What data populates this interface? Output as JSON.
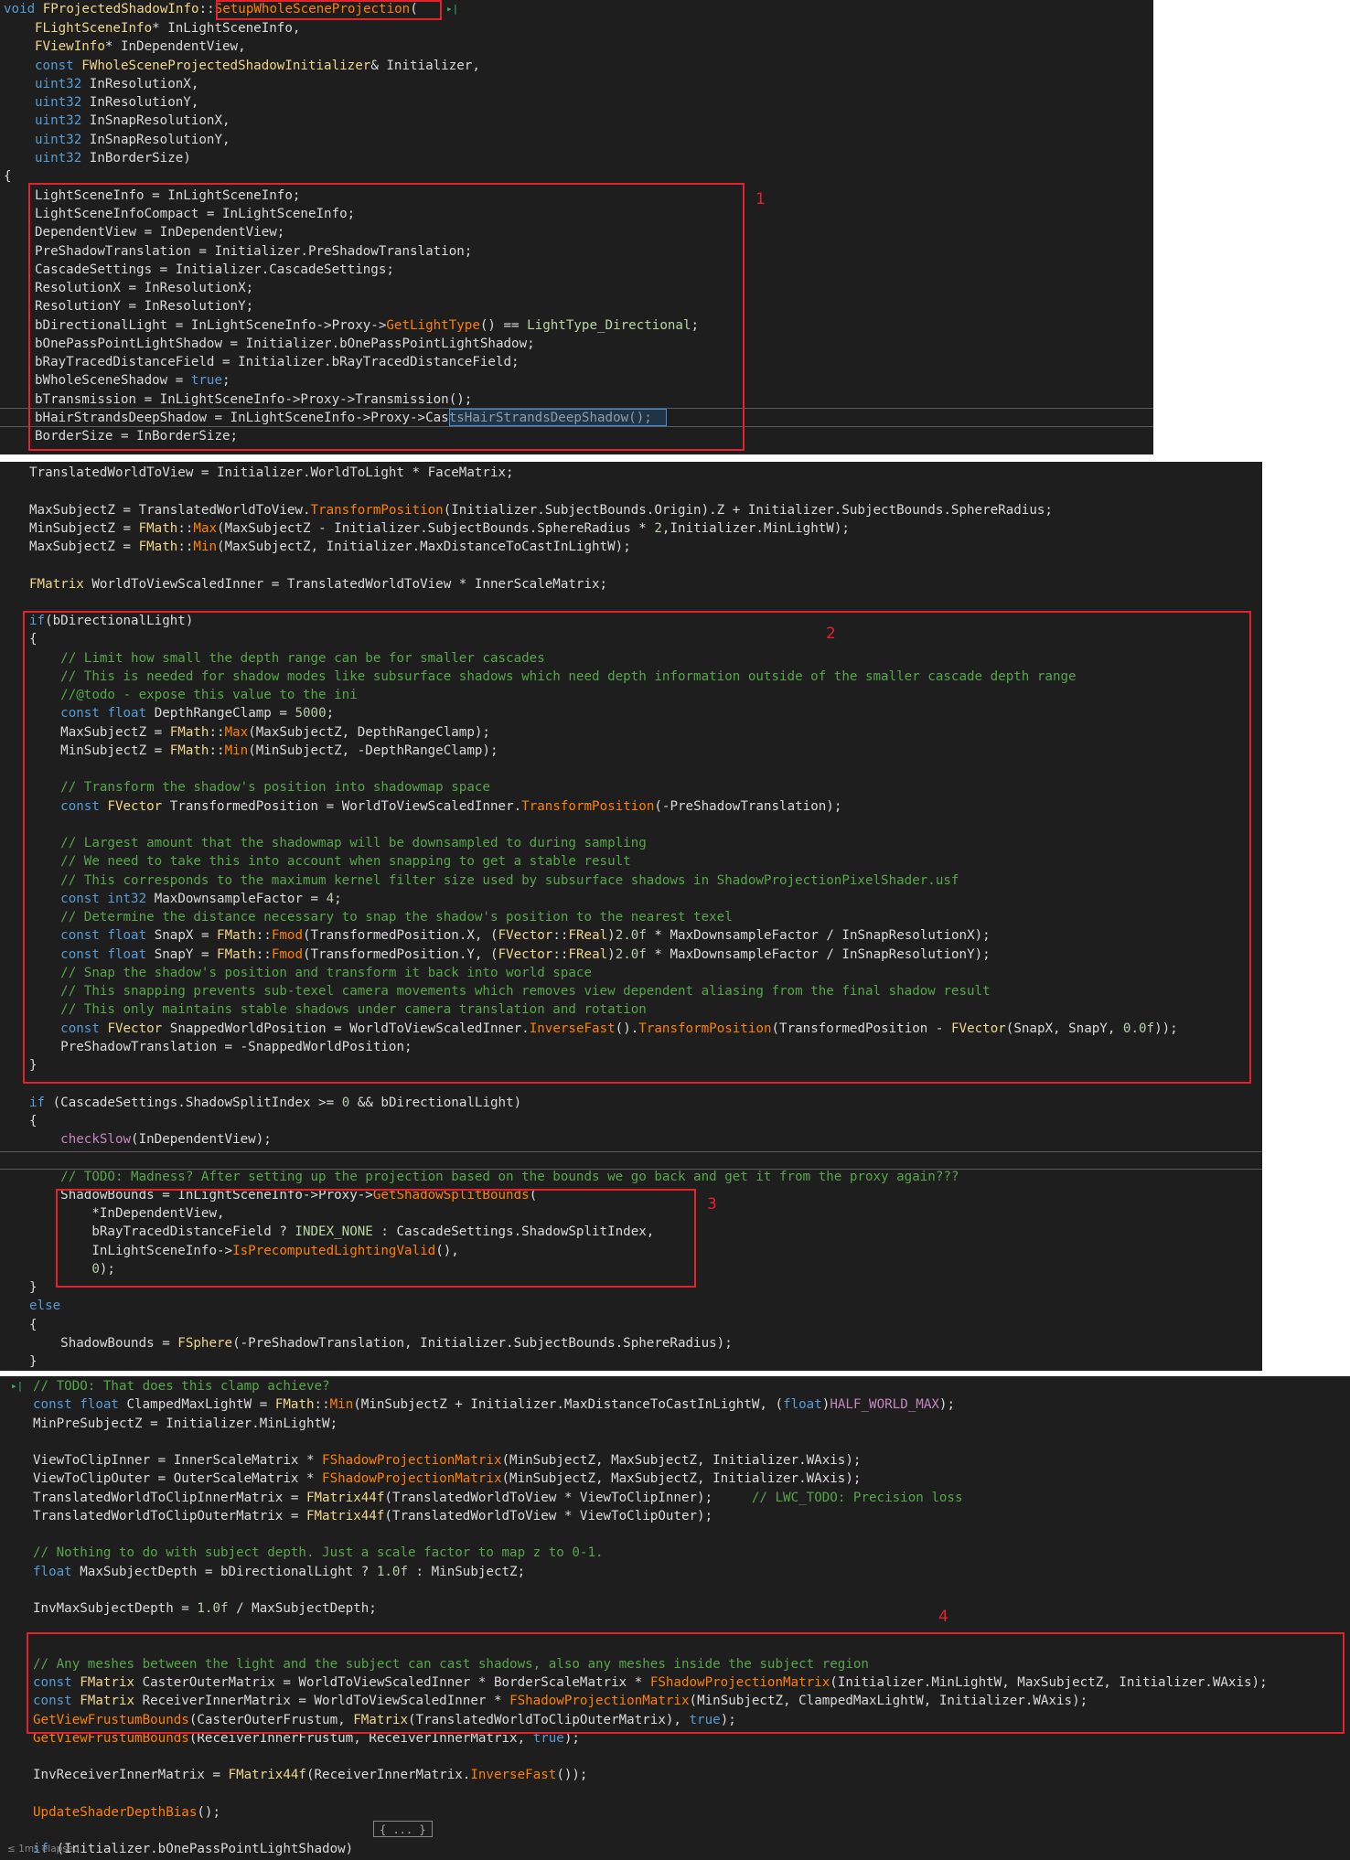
{
  "markers": {
    "m1": "1",
    "m2": "2",
    "m3": "3",
    "m4": "4"
  },
  "panel1": {
    "func_sig": [
      "void FProjectedShadowInfo::",
      "SetupWholeSceneProjection",
      "("
    ],
    "params": [
      "FLightSceneInfo* InLightSceneInfo,",
      "FViewInfo* InDependentView,",
      "const FWholeSceneProjectedShadowInitializer& Initializer,",
      "uint32 InResolutionX,",
      "uint32 InResolutionY,",
      "uint32 InSnapResolutionX,",
      "uint32 InSnapResolutionY,",
      "uint32 InBorderSize)"
    ],
    "brace": "{",
    "assignments": [
      "LightSceneInfo = InLightSceneInfo;",
      "LightSceneInfoCompact = InLightSceneInfo;",
      "DependentView = InDependentView;",
      "PreShadowTranslation = Initializer.PreShadowTranslation;",
      "CascadeSettings = Initializer.CascadeSettings;",
      "ResolutionX = InResolutionX;",
      "ResolutionY = InResolutionY;",
      "bDirectionalLight = InLightSceneInfo->Proxy->GetLightType() == LightType_Directional;",
      "bOnePassPointLightShadow = Initializer.bOnePassPointLightShadow;",
      "bRayTracedDistanceField = Initializer.bRayTracedDistanceField;",
      "bWholeSceneShadow = true;",
      "bTransmission = InLightSceneInfo->Proxy->Transmission();",
      "bHairStrandsDeepShadow = InLightSceneInfo->Proxy->CastsHairStrandsDeepShadow();",
      "BorderSize = InBorderSize;"
    ]
  },
  "panel2": {
    "lines": [
      "TranslatedWorldToView = Initializer.WorldToLight * FaceMatrix;",
      "",
      "MaxSubjectZ = TranslatedWorldToView.TransformPosition(Initializer.SubjectBounds.Origin).Z + Initializer.SubjectBounds.SphereRadius;",
      "MinSubjectZ = FMath::Max(MaxSubjectZ - Initializer.SubjectBounds.SphereRadius * 2,Initializer.MinLightW);",
      "MaxSubjectZ = FMath::Min(MaxSubjectZ, Initializer.MaxDistanceToCastInLightW);",
      "",
      "FMatrix WorldToViewScaledInner = TranslatedWorldToView * InnerScaleMatrix;",
      "",
      "if(bDirectionalLight)",
      "{",
      "    // Limit how small the depth range can be for smaller cascades",
      "    // This is needed for shadow modes like subsurface shadows which need depth information outside of the smaller cascade depth range",
      "    //@todo - expose this value to the ini",
      "    const float DepthRangeClamp = 5000;",
      "    MaxSubjectZ = FMath::Max(MaxSubjectZ, DepthRangeClamp);",
      "    MinSubjectZ = FMath::Min(MinSubjectZ, -DepthRangeClamp);",
      "",
      "    // Transform the shadow's position into shadowmap space",
      "    const FVector TransformedPosition = WorldToViewScaledInner.TransformPosition(-PreShadowTranslation);",
      "",
      "    // Largest amount that the shadowmap will be downsampled to during sampling",
      "    // We need to take this into account when snapping to get a stable result",
      "    // This corresponds to the maximum kernel filter size used by subsurface shadows in ShadowProjectionPixelShader.usf",
      "    const int32 MaxDownsampleFactor = 4;",
      "    // Determine the distance necessary to snap the shadow's position to the nearest texel",
      "    const float SnapX = FMath::Fmod(TransformedPosition.X, (FVector::FReal)2.0f * MaxDownsampleFactor / InSnapResolutionX);",
      "    const float SnapY = FMath::Fmod(TransformedPosition.Y, (FVector::FReal)2.0f * MaxDownsampleFactor / InSnapResolutionY);",
      "    // Snap the shadow's position and transform it back into world space",
      "    // This snapping prevents sub-texel camera movements which removes view dependent aliasing from the final shadow result",
      "    // This only maintains stable shadows under camera translation and rotation",
      "    const FVector SnappedWorldPosition = WorldToViewScaledInner.InverseFast().TransformPosition(TransformedPosition - FVector(SnapX, SnapY, 0.0f));",
      "    PreShadowTranslation = -SnappedWorldPosition;",
      "}",
      "",
      "if (CascadeSettings.ShadowSplitIndex >= 0 && bDirectionalLight)",
      "{",
      "    checkSlow(InDependentView);",
      "",
      "    // TODO: Madness? After setting up the projection based on the bounds we go back and get it from the proxy again???",
      "    ShadowBounds = InLightSceneInfo->Proxy->GetShadowSplitBounds(",
      "        *InDependentView,",
      "        bRayTracedDistanceField ? INDEX_NONE : CascadeSettings.ShadowSplitIndex,",
      "        InLightSceneInfo->IsPrecomputedLightingValid(),",
      "        0);",
      "}",
      "else",
      "{",
      "    ShadowBounds = FSphere(-PreShadowTranslation, Initializer.SubjectBounds.SphereRadius);",
      "}"
    ]
  },
  "panel3": {
    "lines": [
      "// TODO: That does this clamp achieve?",
      "const float ClampedMaxLightW = FMath::Min(MinSubjectZ + Initializer.MaxDistanceToCastInLightW, (float)HALF_WORLD_MAX);",
      "MinPreSubjectZ = Initializer.MinLightW;",
      "",
      "ViewToClipInner = InnerScaleMatrix * FShadowProjectionMatrix(MinSubjectZ, MaxSubjectZ, Initializer.WAxis);",
      "ViewToClipOuter = OuterScaleMatrix * FShadowProjectionMatrix(MinSubjectZ, MaxSubjectZ, Initializer.WAxis);",
      "TranslatedWorldToClipInnerMatrix = FMatrix44f(TranslatedWorldToView * ViewToClipInner);     // LWC_TODO: Precision loss",
      "TranslatedWorldToClipOuterMatrix = FMatrix44f(TranslatedWorldToView * ViewToClipOuter);",
      "",
      "// Nothing to do with subject depth. Just a scale factor to map z to 0-1.",
      "float MaxSubjectDepth = bDirectionalLight ? 1.0f : MinSubjectZ;",
      "",
      "InvMaxSubjectDepth = 1.0f / MaxSubjectDepth;",
      "",
      "",
      "// Any meshes between the light and the subject can cast shadows, also any meshes inside the subject region",
      "const FMatrix CasterOuterMatrix = WorldToViewScaledInner * BorderScaleMatrix * FShadowProjectionMatrix(Initializer.MinLightW, MaxSubjectZ, Initializer.WAxis);",
      "const FMatrix ReceiverInnerMatrix = WorldToViewScaledInner * FShadowProjectionMatrix(MinSubjectZ, ClampedMaxLightW, Initializer.WAxis);",
      "GetViewFrustumBounds(CasterOuterFrustum, FMatrix(TranslatedWorldToClipOuterMatrix), true);",
      "GetViewFrustumBounds(ReceiverInnerFrustum, ReceiverInnerMatrix, true);",
      "",
      "InvReceiverInnerMatrix = FMatrix44f(ReceiverInnerMatrix.InverseFast());",
      "",
      "UpdateShaderDepthBias();",
      "",
      "if (Initializer.bOnePassPointLightShadow)"
    ],
    "fold_label": "{ ... }",
    "status": "≤ 1ms elapsed"
  }
}
